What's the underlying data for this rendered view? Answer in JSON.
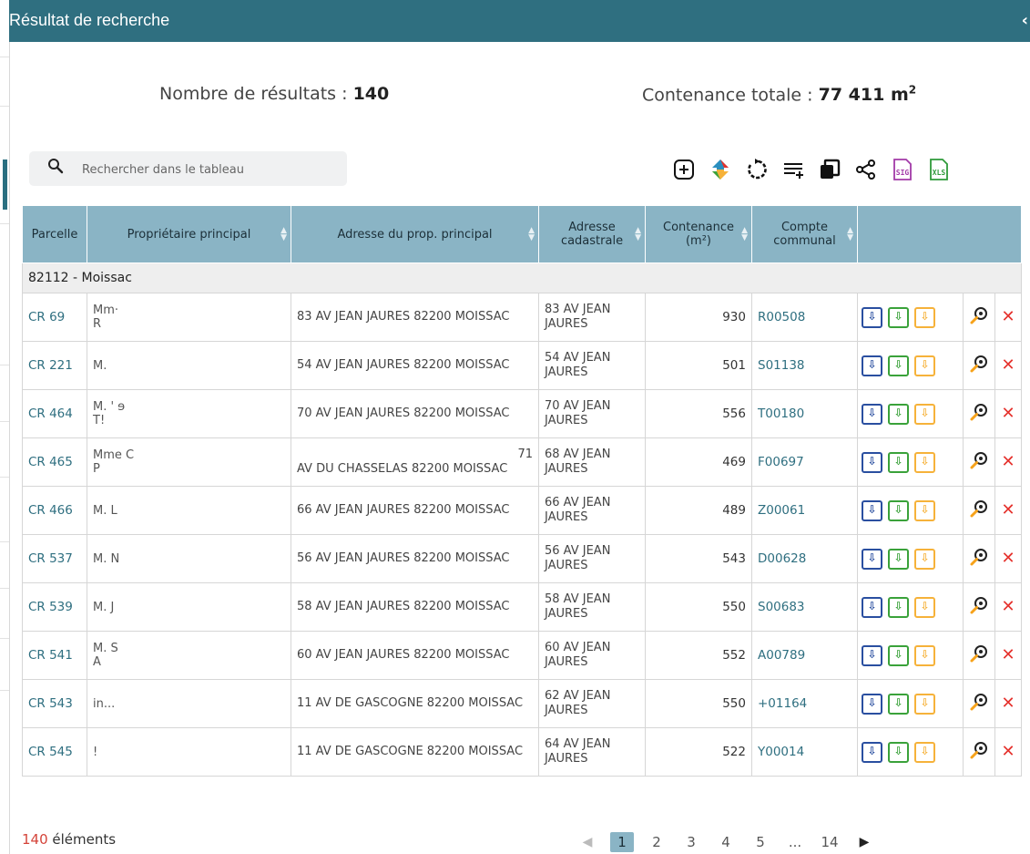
{
  "header": {
    "title": "Résultat de recherche",
    "collapse_glyph": "‹"
  },
  "summary": {
    "count_label": "Nombre de résultats :",
    "count_value": "140",
    "area_label": "Contenance totale :",
    "area_value": "77 411 m",
    "area_exp": "2"
  },
  "search": {
    "placeholder": "Rechercher dans le tableau",
    "icon": "search-icon"
  },
  "toolbar": {
    "icons": [
      "add-icon",
      "switch-icon",
      "refresh-icon",
      "add-column-icon",
      "copy-icon",
      "share-icon",
      "sig-export-icon",
      "xls-export-icon"
    ],
    "sig_label": "SIG",
    "xls_label": "XLS"
  },
  "colors": {
    "header": "#2f6f80",
    "table_header": "#8ab4c5",
    "link": "#2f6f80",
    "delete": "#e5322d",
    "doc_blue": "#2a4fa0",
    "doc_green": "#3aa23a",
    "doc_orange": "#f6b23a"
  },
  "table": {
    "columns": [
      "Parcelle",
      "Propriétaire principal",
      "Adresse du prop. principal",
      "Adresse cadastrale",
      "Contenance (m²)",
      "Compte communal"
    ],
    "group": "82112 - Moissac",
    "rows": [
      {
        "parcel": "CR 69",
        "owner1": "Mm·",
        "owner2": "R",
        "addr_lead": "",
        "addr": "83 AV JEAN JAURES 82200 MOISSAC",
        "cadastre": "83 AV JEAN JAURES",
        "area": "930",
        "compte": "R00508"
      },
      {
        "parcel": "CR 221",
        "owner1": "M.",
        "owner2": "",
        "addr_lead": "",
        "addr": "54 AV JEAN JAURES 82200 MOISSAC",
        "cadastre": "54 AV JEAN JAURES",
        "area": "501",
        "compte": "S01138"
      },
      {
        "parcel": "CR 464",
        "owner1": "M. ' ɘ",
        "owner2": "T!",
        "addr_lead": "",
        "addr": "70 AV JEAN JAURES 82200 MOISSAC",
        "cadastre": "70 AV JEAN JAURES",
        "area": "556",
        "compte": "T00180"
      },
      {
        "parcel": "CR 465",
        "owner1": "Mme C",
        "owner2": "P",
        "addr_lead": "71",
        "addr": "AV DU CHASSELAS 82200 MOISSAC",
        "cadastre": "68 AV JEAN JAURES",
        "area": "469",
        "compte": "F00697"
      },
      {
        "parcel": "CR 466",
        "owner1": "M. L",
        "owner2": "",
        "addr_lead": "",
        "addr": "66 AV JEAN JAURES 82200 MOISSAC",
        "cadastre": "66 AV JEAN JAURES",
        "area": "489",
        "compte": "Z00061"
      },
      {
        "parcel": "CR 537",
        "owner1": "M. N",
        "owner2": "",
        "addr_lead": "",
        "addr": "56 AV JEAN JAURES 82200 MOISSAC",
        "cadastre": "56 AV JEAN JAURES",
        "area": "543",
        "compte": "D00628"
      },
      {
        "parcel": "CR 539",
        "owner1": "M. J",
        "owner2": "",
        "addr_lead": "",
        "addr": "58 AV JEAN JAURES 82200 MOISSAC",
        "cadastre": "58 AV JEAN JAURES",
        "area": "550",
        "compte": "S00683"
      },
      {
        "parcel": "CR 541",
        "owner1": "M. S",
        "owner2": "A",
        "addr_lead": "",
        "addr": "60 AV JEAN JAURES 82200 MOISSAC",
        "cadastre": "60 AV JEAN JAURES",
        "area": "552",
        "compte": "A00789"
      },
      {
        "parcel": "CR 543",
        "owner1": "",
        "owner2": "in...",
        "addr_lead": "",
        "addr": "11 AV DE GASCOGNE 82200 MOISSAC",
        "cadastre": "62 AV JEAN JAURES",
        "area": "550",
        "compte": "+01164"
      },
      {
        "parcel": "CR 545",
        "owner1": "!",
        "owner2": "",
        "addr_lead": "",
        "addr": "11 AV DE GASCOGNE 82200 MOISSAC",
        "cadastre": "64 AV JEAN JAURES",
        "area": "522",
        "compte": "Y00014"
      }
    ]
  },
  "footer": {
    "count_value": "140",
    "count_label": " éléments",
    "pages": [
      "1",
      "2",
      "3",
      "4",
      "5",
      "...",
      "14"
    ],
    "active_page": "1",
    "prev_glyph": "◀",
    "next_glyph": "▶"
  }
}
